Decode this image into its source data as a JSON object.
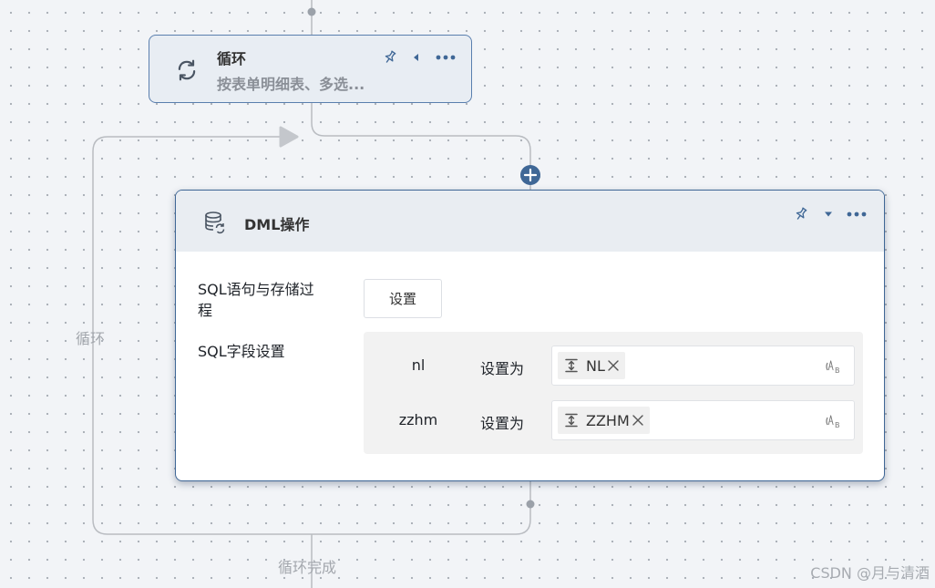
{
  "loop_node": {
    "title": "循环",
    "description": "按表单明细表、多选..."
  },
  "dml_node": {
    "title": "DML操作",
    "sql_label": "SQL语句与存储过程",
    "set_button": "设置",
    "field_settings_label": "SQL字段设置",
    "mappings": [
      {
        "field": "nl",
        "operator": "设置为",
        "value": "NL"
      },
      {
        "field": "zzhm",
        "operator": "设置为",
        "value": "ZZHM"
      }
    ]
  },
  "canvas": {
    "loop_edge_label": "循环",
    "loop_done_label": "循环完成"
  },
  "watermark": "CSDN @月与清酒",
  "colors": {
    "node_border": "#5a7fae",
    "accent": "#3f6796",
    "connector": "#b9bcc1"
  }
}
